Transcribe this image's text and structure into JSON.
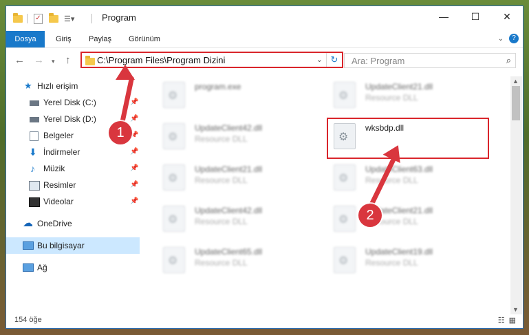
{
  "title": "Program",
  "ribbon": {
    "tabs": [
      "Dosya",
      "Giriş",
      "Paylaş",
      "Görünüm"
    ]
  },
  "nav": {
    "address": "C:\\Program Files\\Program Dizini",
    "search_placeholder": "Ara: Program"
  },
  "sidebar": {
    "quick_access": "Hızlı erişim",
    "items": [
      "Yerel Disk (C:)",
      "Yerel Disk (D:)",
      "Belgeler",
      "İndirmeler",
      "Müzik",
      "Resimler",
      "Videolar"
    ],
    "onedrive": "OneDrive",
    "this_pc": "Bu bilgisayar",
    "network": "Ağ"
  },
  "files": [
    {
      "name": "program.exe",
      "desc": ""
    },
    {
      "name": "UpdateClient21.dll",
      "desc": "Resource DLL"
    },
    {
      "name": "UpdateClient42.dll",
      "desc": "Resource DLL"
    },
    {
      "name": "wksbdp.dll",
      "desc": ""
    },
    {
      "name": "UpdateClient21.dll",
      "desc": "Resource DLL"
    },
    {
      "name": "UpdateClient63.dll",
      "desc": "Resource DLL"
    },
    {
      "name": "UpdateClient42.dll",
      "desc": "Resource DLL"
    },
    {
      "name": "UpdateClient21.dll",
      "desc": "Resource DLL"
    },
    {
      "name": "UpdateClient65.dll",
      "desc": "Resource DLL"
    },
    {
      "name": "UpdateClient19.dll",
      "desc": "Resource DLL"
    }
  ],
  "status": {
    "count": "154 öğe"
  },
  "annotations": {
    "step1": "1",
    "step2": "2"
  },
  "colors": {
    "accent": "#1979ca",
    "highlight": "#d9252b"
  }
}
